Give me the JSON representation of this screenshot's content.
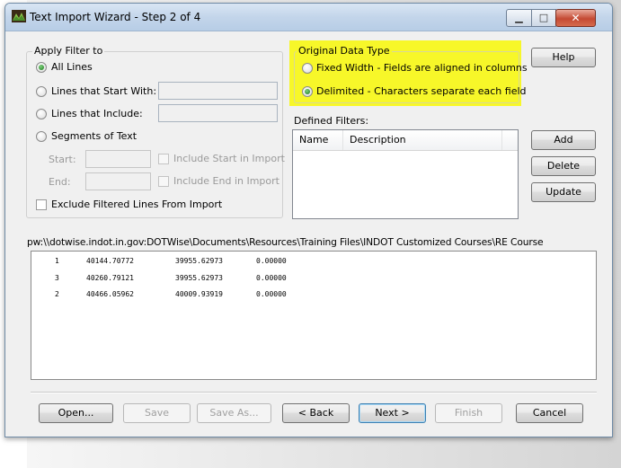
{
  "window": {
    "title": "Text Import Wizard - Step 2 of 4",
    "caption_buttons": {
      "minimize_icon": "minimize-icon",
      "maximize_icon": "maximize-icon",
      "close_icon": "close-icon"
    }
  },
  "apply_filter": {
    "legend": "Apply Filter to",
    "options": [
      {
        "label": "All Lines",
        "checked": true
      },
      {
        "label": "Lines that Start With:",
        "checked": false
      },
      {
        "label": "Lines that Include:",
        "checked": false
      },
      {
        "label": "Segments of Text",
        "checked": false
      }
    ],
    "start_label": "Start:",
    "end_label": "End:",
    "include_start_label": "Include Start in Import",
    "include_end_label": "Include End in Import",
    "exclude_label": "Exclude Filtered Lines From Import"
  },
  "original_data_type": {
    "legend": "Original Data Type",
    "fixed_width_label": "Fixed Width - Fields are aligned in columns",
    "delimited_label": "Delimited - Characters separate each field",
    "selected": "delimited",
    "highlight_color": "#f7f729"
  },
  "defined_filters": {
    "label": "Defined Filters:",
    "columns": [
      "Name",
      "Description"
    ]
  },
  "side_buttons": {
    "help": "Help",
    "add": "Add",
    "delete": "Delete",
    "update": "Update"
  },
  "file_path": "pw:\\\\dotwise.indot.in.gov:DOTWise\\Documents\\Resources\\Training Files\\INDOT Customized Courses\\RE Course",
  "data_rows": [
    [
      "1",
      "40144.70772",
      "39955.62973",
      "0.00000"
    ],
    [
      "3",
      "40260.79121",
      "39955.62973",
      "0.00000"
    ],
    [
      "2",
      "40466.05962",
      "40009.93919",
      "0.00000"
    ]
  ],
  "footer_buttons": {
    "open": "Open...",
    "save": "Save",
    "save_as": "Save As...",
    "back": "< Back",
    "next": "Next >",
    "finish": "Finish",
    "cancel": "Cancel"
  }
}
